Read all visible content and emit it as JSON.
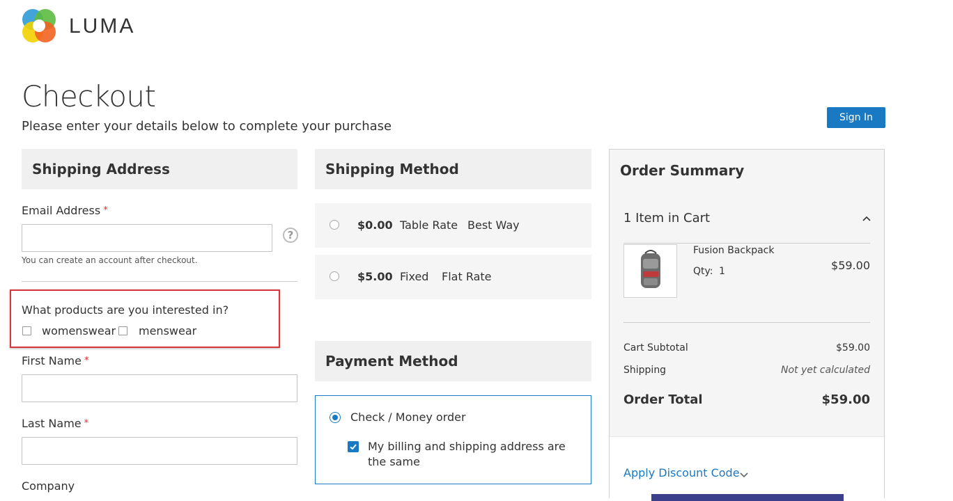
{
  "header": {
    "logo_text": "LUMA",
    "sign_in_label": "Sign In"
  },
  "page": {
    "title": "Checkout",
    "subtitle": "Please enter your details below to complete your purchase"
  },
  "shipping_address": {
    "heading": "Shipping Address",
    "email_label": "Email Address",
    "email_value": "",
    "email_note": "You can create an account after checkout.",
    "interest_question": "What products are you interested in?",
    "interest_options": [
      {
        "label": "womenswear",
        "checked": false
      },
      {
        "label": "menswear",
        "checked": false
      }
    ],
    "first_name_label": "First Name",
    "last_name_label": "Last Name",
    "company_label": "Company",
    "required_mark": "*"
  },
  "shipping_method": {
    "heading": "Shipping Method",
    "options": [
      {
        "price": "$0.00",
        "carrier": "Table Rate",
        "name": "Best Way",
        "selected": false
      },
      {
        "price": "$5.00",
        "carrier": "Fixed",
        "name": "Flat Rate",
        "selected": false
      }
    ]
  },
  "payment_method": {
    "heading": "Payment Method",
    "option_label": "Check / Money order",
    "selected": true,
    "billing_same_label": "My billing and shipping address are the same",
    "billing_same_checked": true
  },
  "order_summary": {
    "heading": "Order Summary",
    "items_count": "1 Item in Cart",
    "item": {
      "name": "Fusion Backpack",
      "qty_label": "Qty:",
      "qty": "1",
      "price": "$59.00"
    },
    "subtotal_label": "Cart Subtotal",
    "subtotal_value": "$59.00",
    "shipping_label": "Shipping",
    "shipping_value": "Not yet calculated",
    "total_label": "Order Total",
    "total_value": "$59.00",
    "discount_link": "Apply Discount Code"
  },
  "colors": {
    "accent": "#1979c3",
    "required": "#e02b27",
    "highlight_box": "#d9343a"
  }
}
